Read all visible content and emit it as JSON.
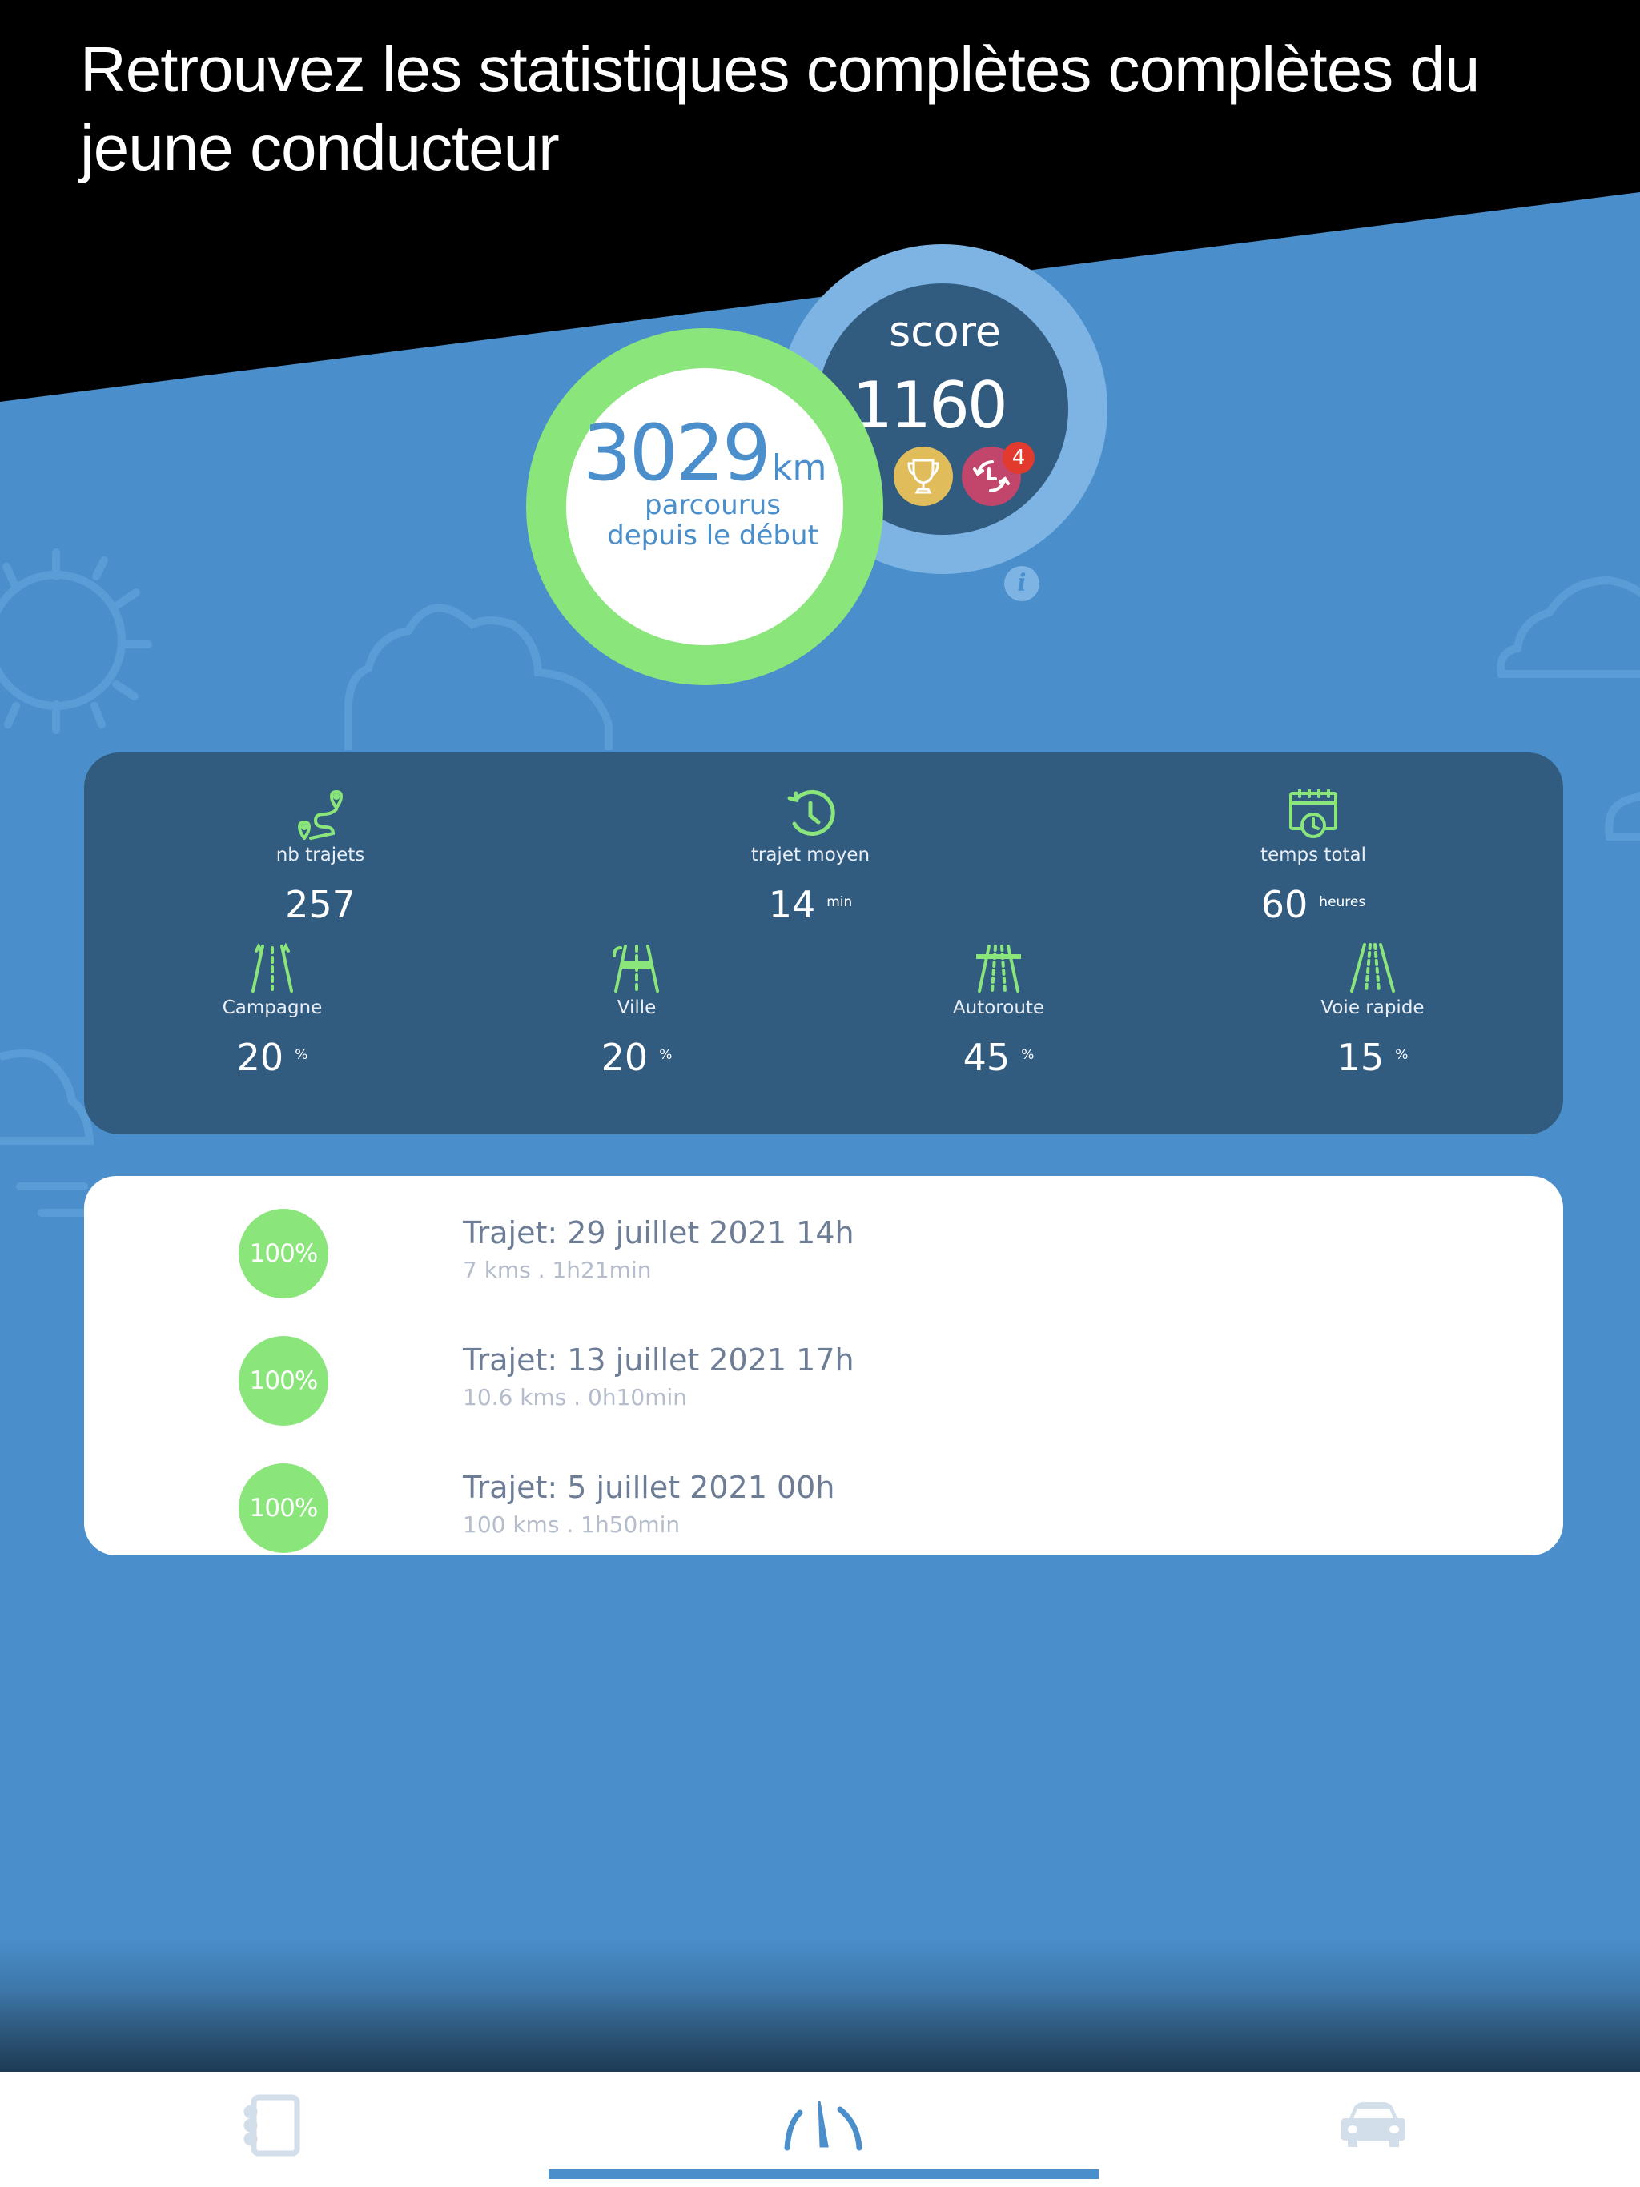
{
  "banner": {
    "title": "Retrouvez les statistiques complètes  complètes du jeune conducteur"
  },
  "distance": {
    "value": "3029",
    "unit": "km",
    "label_line1": "parcourus",
    "label_line2": "depuis le début"
  },
  "score": {
    "label": "score",
    "value": "1160",
    "badge_count": "4",
    "info_glyph": "i"
  },
  "stats": {
    "top": [
      {
        "icon": "route-pin-icon",
        "label": "nb trajets",
        "value": "257",
        "unit": ""
      },
      {
        "icon": "history-clock-icon",
        "label": "trajet moyen",
        "value": "14",
        "unit": "min"
      },
      {
        "icon": "calendar-clock-icon",
        "label": "temps total",
        "value": "60",
        "unit": "heures"
      }
    ],
    "road_types": [
      {
        "icon": "country-road-icon",
        "label": "Campagne",
        "value": "20",
        "unit": "%"
      },
      {
        "icon": "city-road-icon",
        "label": "Ville",
        "value": "20",
        "unit": "%"
      },
      {
        "icon": "highway-icon",
        "label": "Autoroute",
        "value": "45",
        "unit": "%"
      },
      {
        "icon": "expressway-icon",
        "label": "Voie rapide",
        "value": "15",
        "unit": "%"
      }
    ]
  },
  "trips": [
    {
      "score": "100%",
      "title": "Trajet: 29 juillet 2021 14h",
      "details": "7 kms . 1h21min"
    },
    {
      "score": "100%",
      "title": "Trajet: 13 juillet 2021 17h",
      "details": "10.6 kms . 0h10min"
    },
    {
      "score": "100%",
      "title": "Trajet: 5 juillet 2021 00h",
      "details": "100 kms . 1h50min"
    }
  ],
  "tabbar": {
    "tabs": [
      {
        "icon": "notebook-icon",
        "active": false
      },
      {
        "icon": "dashboard-gauge-icon",
        "active": true
      },
      {
        "icon": "car-icon",
        "active": false
      }
    ]
  },
  "colors": {
    "background": "#4a8fcb",
    "panel": "#325b80",
    "green": "#8ae57b",
    "score_ring": "#7db4e3",
    "trophy": "#e0bd5a",
    "replay": "#c2456b",
    "badge": "#e33a2e"
  }
}
